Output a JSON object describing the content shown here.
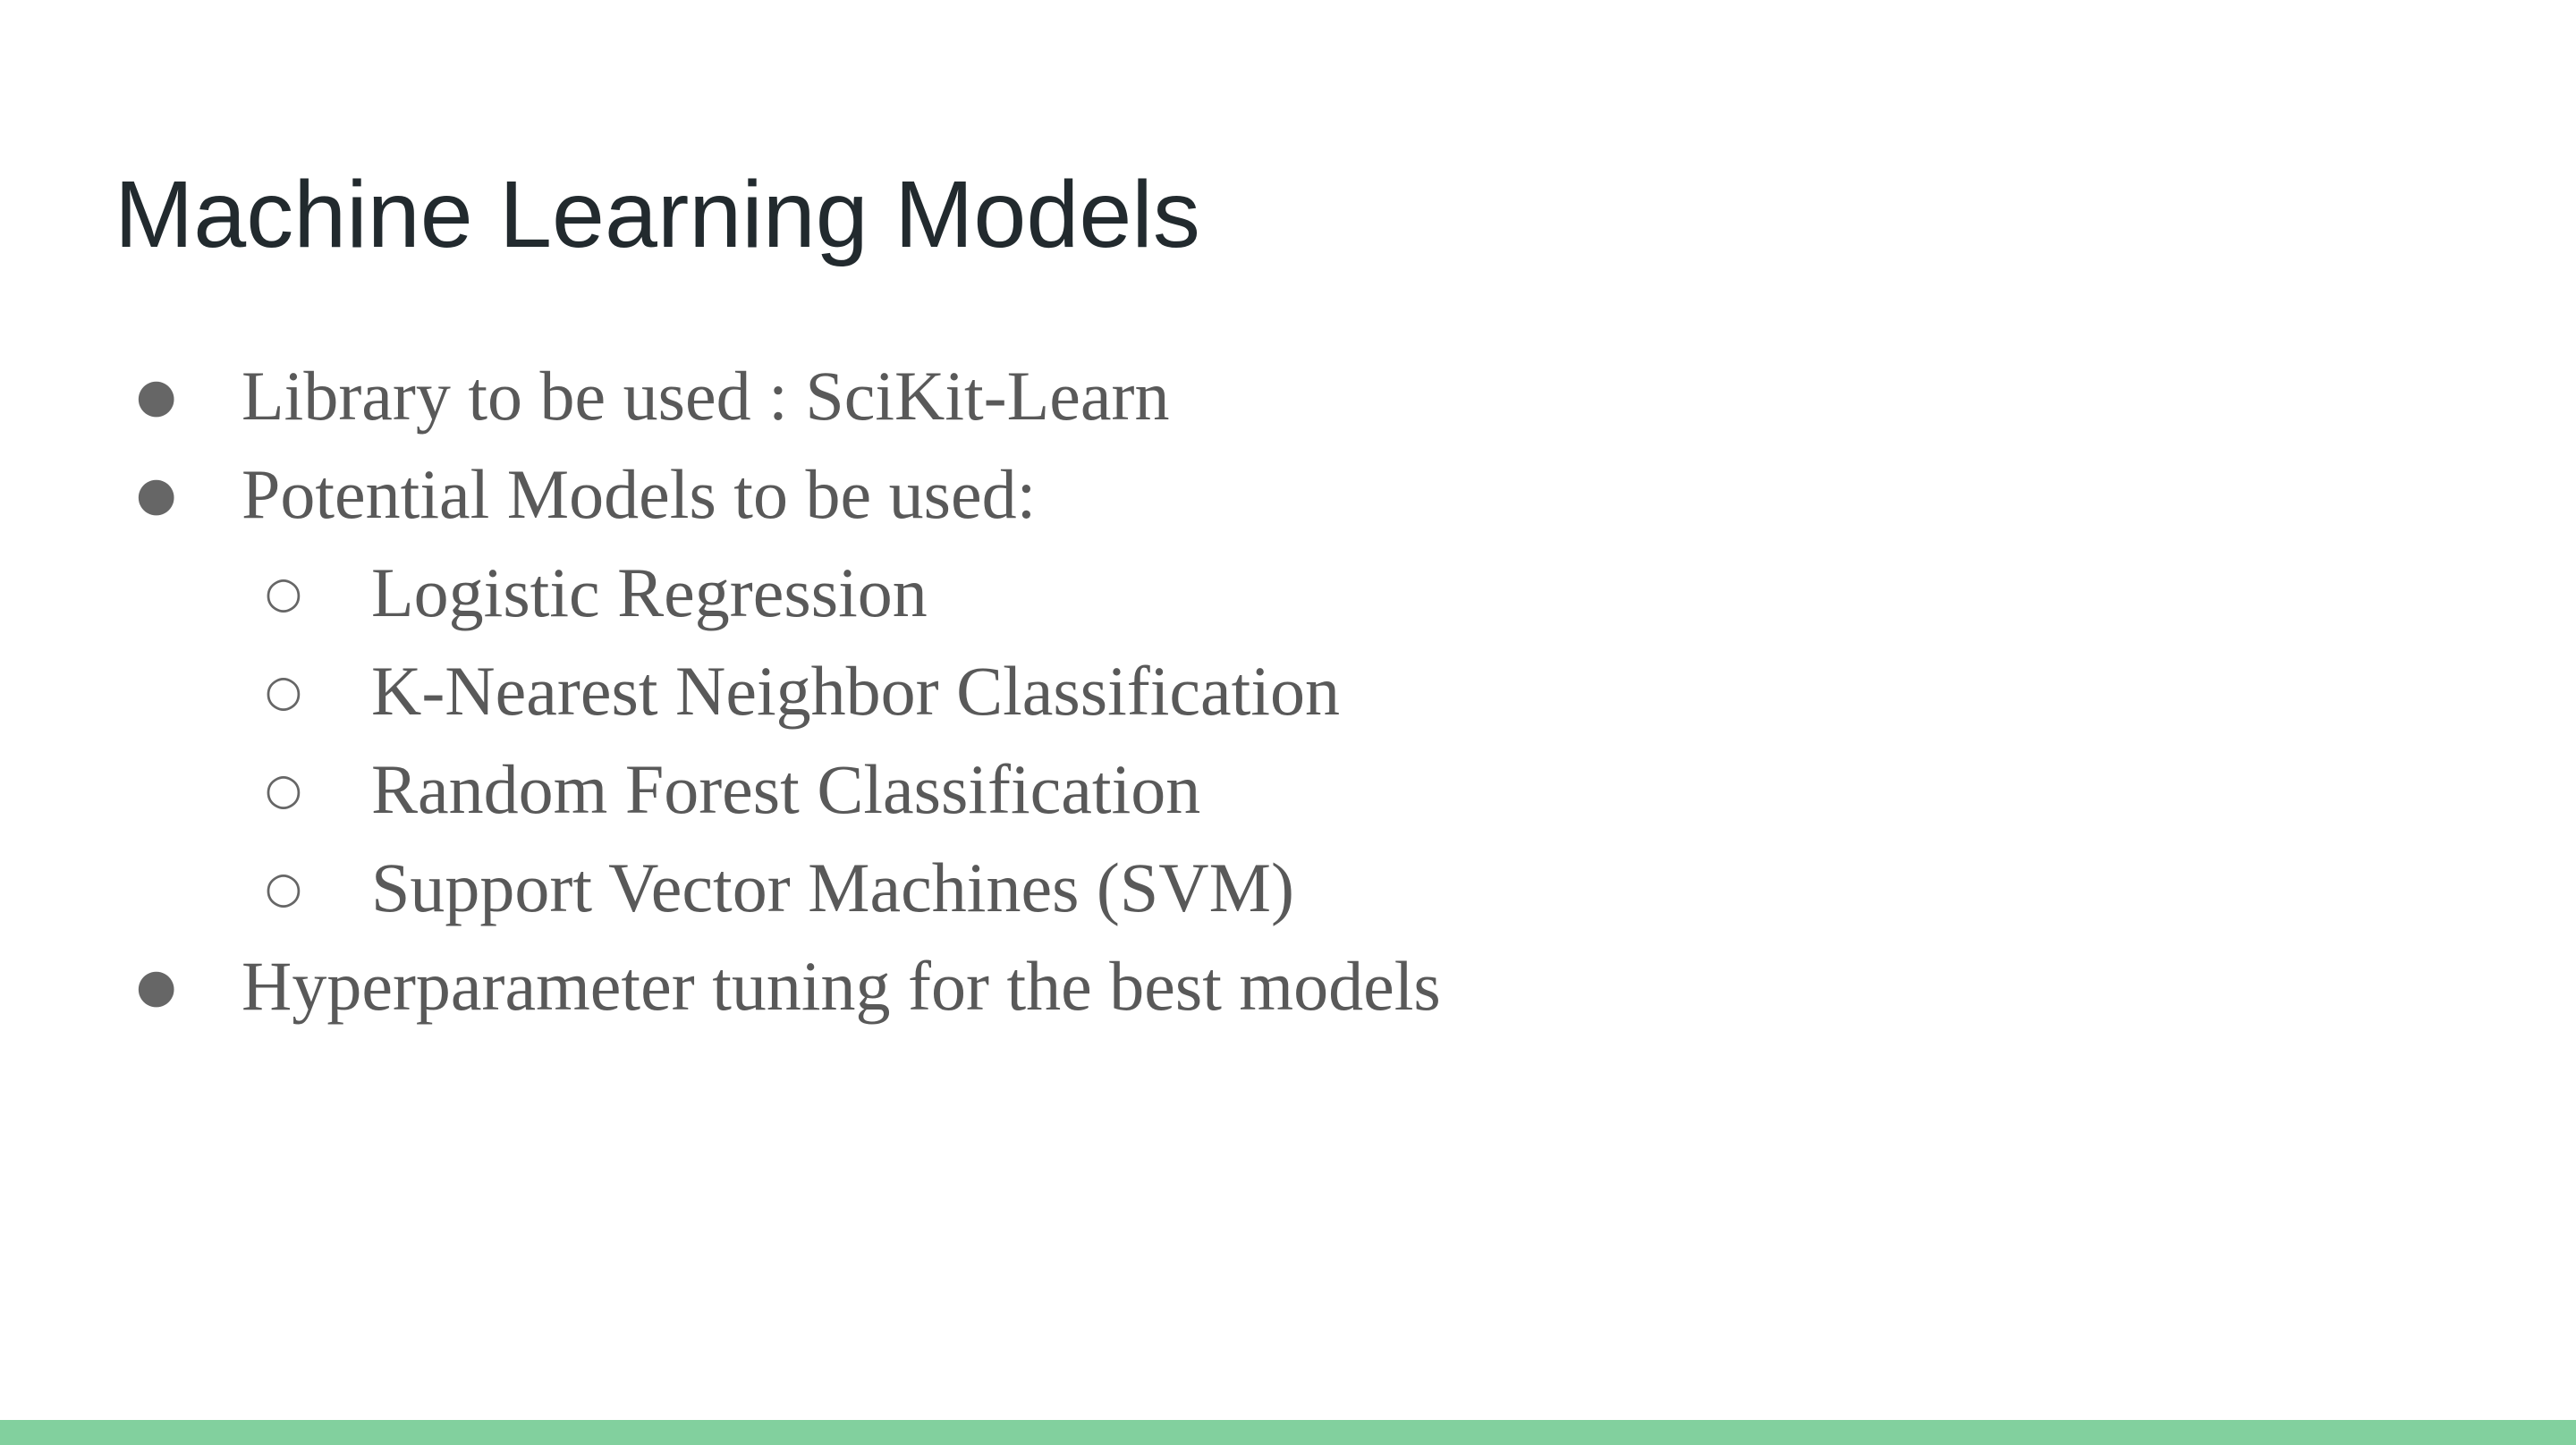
{
  "slide": {
    "title": "Machine Learning Models",
    "bullets": [
      {
        "level": 1,
        "marker": "●",
        "text": "Library to be used : SciKit-Learn"
      },
      {
        "level": 1,
        "marker": "●",
        "text": "Potential Models to be used:"
      },
      {
        "level": 2,
        "marker": "○",
        "text": "Logistic Regression"
      },
      {
        "level": 2,
        "marker": "○",
        "text": "K-Nearest Neighbor Classification"
      },
      {
        "level": 2,
        "marker": "○",
        "text": "Random Forest Classification"
      },
      {
        "level": 2,
        "marker": "○",
        "text": "Support Vector Machines (SVM)"
      },
      {
        "level": 1,
        "marker": "●",
        "text": "Hyperparameter tuning for the best models"
      }
    ]
  },
  "theme": {
    "accent_color": "#82d09e",
    "title_color": "#222a2e",
    "body_color": "#595959"
  }
}
